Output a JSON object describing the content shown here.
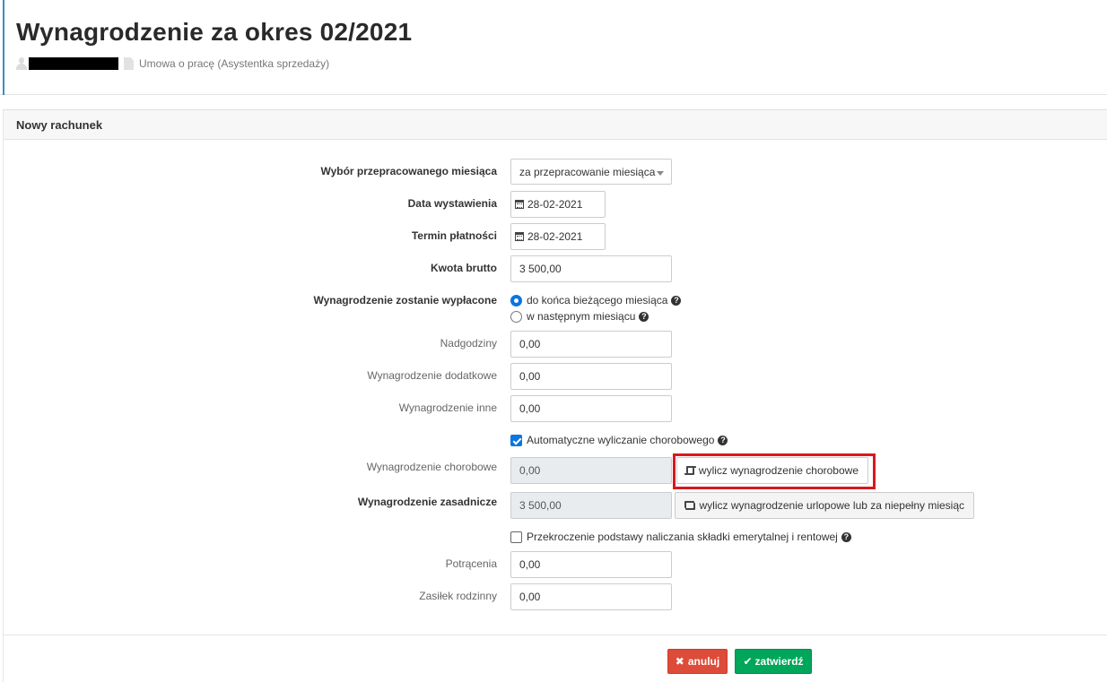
{
  "header": {
    "title": "Wynagrodzenie za okres 02/2021",
    "contract": "Umowa o pracę (Asystentka sprzedaży)"
  },
  "panel": {
    "title": "Nowy rachunek"
  },
  "form": {
    "month_choice": {
      "label": "Wybór przepracowanego miesiąca",
      "value": "za przepracowanie miesiąca"
    },
    "issue_date": {
      "label": "Data wystawienia",
      "value": "28-02-2021"
    },
    "payment_due": {
      "label": "Termin płatności",
      "value": "28-02-2021"
    },
    "gross_amount": {
      "label": "Kwota brutto",
      "value": "3 500,00"
    },
    "payout": {
      "label": "Wynagrodzenie zostanie wypłacone",
      "option_current": "do końca bieżącego miesiąca",
      "option_next": "w następnym miesiącu",
      "selected": "do końca bieżącego miesiąca"
    },
    "overtime": {
      "label": "Nadgodziny",
      "value": "0,00"
    },
    "additional_pay": {
      "label": "Wynagrodzenie dodatkowe",
      "value": "0,00"
    },
    "other_pay": {
      "label": "Wynagrodzenie inne",
      "value": "0,00"
    },
    "auto_sick": {
      "label": "Automatyczne wyliczanie chorobowego",
      "checked": true
    },
    "sick_pay": {
      "label": "Wynagrodzenie chorobowe",
      "value": "0,00",
      "button": "wylicz wynagrodzenie chorobowe"
    },
    "base_pay": {
      "label": "Wynagrodzenie zasadnicze",
      "value": "3 500,00",
      "button": "wylicz wynagrodzenie urlopowe lub za niepełny miesiąc"
    },
    "pension_limit": {
      "label": "Przekroczenie podstawy naliczania składki emerytalnej i rentowej",
      "checked": false
    },
    "deductions": {
      "label": "Potrącenia",
      "value": "0,00"
    },
    "family_allowance": {
      "label": "Zasiłek rodzinny",
      "value": "0,00"
    }
  },
  "actions": {
    "cancel": "anuluj",
    "confirm": "zatwierdź"
  },
  "colors": {
    "accent": "#3c8dbc",
    "cancel": "#dd4b39",
    "confirm": "#00a65a",
    "highlight": "#d7191f",
    "radio_check": "#0b75e0"
  }
}
